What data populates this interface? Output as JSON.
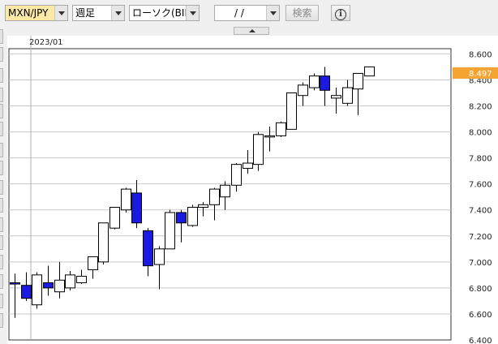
{
  "toolbar": {
    "pair": "MXN/JPY",
    "period": "週足",
    "price_type": "ローソク(BID)",
    "date_value": "/ /",
    "search_label": "検索",
    "info_glyph": "i"
  },
  "chart_data": {
    "type": "candlestick",
    "x_labels": [
      "2023/01"
    ],
    "y_ticks": [
      "8.600",
      "8.400",
      "8.200",
      "8.000",
      "7.800",
      "7.600",
      "7.400",
      "7.200",
      "7.000",
      "6.800",
      "6.600",
      "6.400"
    ],
    "ylim": [
      6.4,
      8.64
    ],
    "current_price": "8.497",
    "colors": {
      "up_fill": "#ffffff",
      "down_fill": "#1a1ae0",
      "price_badge": "#f4a431",
      "grid": "#c8c8c8"
    },
    "candles": [
      {
        "o": 6.84,
        "h": 6.91,
        "l": 6.57,
        "c": 6.83
      },
      {
        "o": 6.82,
        "h": 6.92,
        "l": 6.7,
        "c": 6.72
      },
      {
        "o": 6.67,
        "h": 6.92,
        "l": 6.64,
        "c": 6.9
      },
      {
        "o": 6.84,
        "h": 6.97,
        "l": 6.74,
        "c": 6.8
      },
      {
        "o": 6.77,
        "h": 7.0,
        "l": 6.72,
        "c": 6.86
      },
      {
        "o": 6.8,
        "h": 6.93,
        "l": 6.78,
        "c": 6.9
      },
      {
        "o": 6.84,
        "h": 6.94,
        "l": 6.83,
        "c": 6.89
      },
      {
        "o": 6.94,
        "h": 7.04,
        "l": 6.87,
        "c": 7.04
      },
      {
        "o": 7.0,
        "h": 7.3,
        "l": 6.98,
        "c": 7.3
      },
      {
        "o": 7.26,
        "h": 7.42,
        "l": 7.25,
        "c": 7.42
      },
      {
        "o": 7.4,
        "h": 7.57,
        "l": 7.38,
        "c": 7.56
      },
      {
        "o": 7.53,
        "h": 7.63,
        "l": 7.26,
        "c": 7.3
      },
      {
        "o": 7.24,
        "h": 7.26,
        "l": 6.89,
        "c": 6.97
      },
      {
        "o": 6.98,
        "h": 7.12,
        "l": 6.79,
        "c": 7.1
      },
      {
        "o": 7.1,
        "h": 7.4,
        "l": 7.1,
        "c": 7.38
      },
      {
        "o": 7.38,
        "h": 7.4,
        "l": 7.15,
        "c": 7.3
      },
      {
        "o": 7.28,
        "h": 7.44,
        "l": 7.27,
        "c": 7.42
      },
      {
        "o": 7.42,
        "h": 7.46,
        "l": 7.35,
        "c": 7.44
      },
      {
        "o": 7.44,
        "h": 7.57,
        "l": 7.32,
        "c": 7.56
      },
      {
        "o": 7.5,
        "h": 7.62,
        "l": 7.4,
        "c": 7.59
      },
      {
        "o": 7.59,
        "h": 7.76,
        "l": 7.54,
        "c": 7.75
      },
      {
        "o": 7.72,
        "h": 7.86,
        "l": 7.68,
        "c": 7.76
      },
      {
        "o": 7.75,
        "h": 8.0,
        "l": 7.7,
        "c": 7.98
      },
      {
        "o": 7.97,
        "h": 8.04,
        "l": 7.85,
        "c": 7.97
      },
      {
        "o": 7.97,
        "h": 8.08,
        "l": 7.96,
        "c": 8.07
      },
      {
        "o": 8.02,
        "h": 8.3,
        "l": 8.02,
        "c": 8.3
      },
      {
        "o": 8.28,
        "h": 8.38,
        "l": 8.2,
        "c": 8.36
      },
      {
        "o": 8.34,
        "h": 8.45,
        "l": 8.32,
        "c": 8.43
      },
      {
        "o": 8.43,
        "h": 8.5,
        "l": 8.2,
        "c": 8.32
      },
      {
        "o": 8.26,
        "h": 8.34,
        "l": 8.14,
        "c": 8.28
      },
      {
        "o": 8.22,
        "h": 8.4,
        "l": 8.2,
        "c": 8.34
      },
      {
        "o": 8.33,
        "h": 8.44,
        "l": 8.13,
        "c": 8.45
      },
      {
        "o": 8.43,
        "h": 8.5,
        "l": 8.43,
        "c": 8.5
      }
    ]
  }
}
